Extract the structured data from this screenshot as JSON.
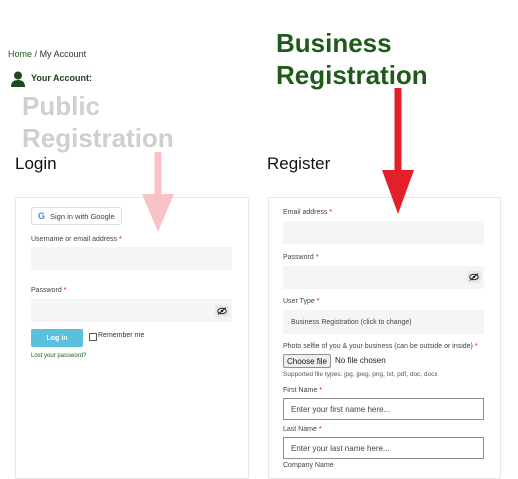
{
  "breadcrumb": {
    "home": "Home",
    "separator": "/",
    "current": "My Account"
  },
  "account": {
    "label": "Your Account:"
  },
  "annotations": {
    "public_line1": "Public",
    "public_line2": "Registration",
    "business_line1": "Business",
    "business_line2": "Registration",
    "public_arrow_color": "#f9c3c6",
    "business_arrow_color": "#e3202a"
  },
  "login": {
    "heading": "Login",
    "google_button": "Sign in with Google",
    "username_label": "Username or email address",
    "password_label": "Password",
    "required_mark": "*",
    "submit_label": "Log in",
    "remember_label": "Remember me",
    "lost_password": "Lost your password?"
  },
  "register": {
    "heading": "Register",
    "email_label": "Email address",
    "password_label": "Password",
    "user_type_label": "User Type",
    "user_type_value": "Business Registration (click to change)",
    "photo_label": "Photo selfie of you & your business (can be outside or inside)",
    "choose_file": "Choose file",
    "no_file": "No file chosen",
    "file_types": "Supported file types: jpg, jpeg, png, txt, pdf, doc, docx",
    "first_name_label": "First Name",
    "first_name_placeholder": "Enter your first name here...",
    "last_name_label": "Last Name",
    "last_name_placeholder": "Enter your last name here...",
    "company_label": "Company Name",
    "required_mark": "*"
  },
  "colors": {
    "brand_green": "#1f5a1a",
    "login_button": "#5bc0de"
  }
}
